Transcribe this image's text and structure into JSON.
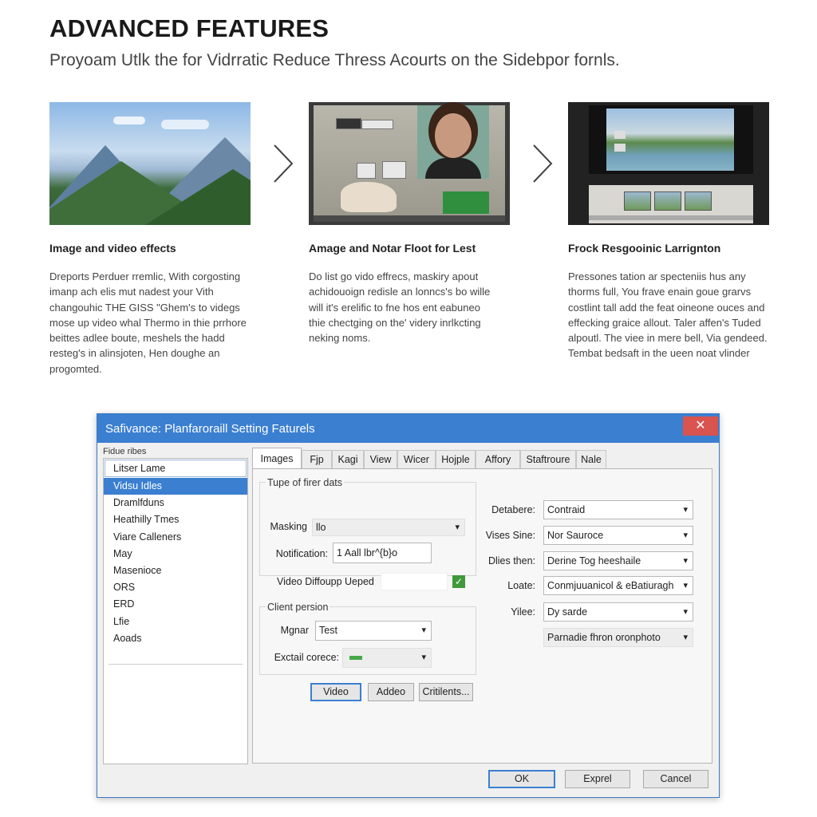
{
  "header": {
    "title": "ADVANCED FEATURES",
    "subtitle": "Proyoam Utlk the for Vidrratic Reduce Thress Acourts on the Sidebpor fornls."
  },
  "features": [
    {
      "title": "Image and video effects",
      "lines": [
        "Dreports Perduer rremlic, With corgosting",
        "imanp ach elis mut nadest your Vith",
        "changouhic THE GISS \"Ghem's to videgs",
        "mose up video whal Thermo in thie prrhore",
        "beittes adlee boute, meshels the hadd",
        "resteg's in alinsjoten, Hen doughe an",
        "progomted."
      ]
    },
    {
      "title": "Amage and Notar Floot for Lest",
      "lines": [
        "Do list go vido effrecs, maskiry apout",
        "achidouoign redisle an lonncs's bo wille",
        "will it's erelific to fne hos ent eabuneo",
        "thie chectging on the' videry inrlkcting",
        "neking noms."
      ]
    },
    {
      "title": "Frock Resgooinic Larrignton",
      "lines": [
        "Pressones tation ar specteniis hus any",
        "thorms full, You frave enain goue grarvs",
        "costlint tall add the feat oineone ouces and",
        "effecking graice allout. Taler affen's Tuded",
        "alpoutl. The viee in mere bell, Via gendeed.",
        "Tembat bedsaft in the ueen noat vlinder"
      ]
    }
  ],
  "dialog": {
    "title": "Safivance: Planfaroraill Setting Faturels",
    "close_glyph": "✕",
    "sidebar": {
      "label": "Fidue ribes",
      "items": [
        "Litser Lame",
        "Vidsu Idles",
        "Dramlfduns",
        "Heathilly Tmes",
        "Viare Calleners",
        "May",
        "Masenioce",
        "ORS",
        "ERD",
        "Lfie",
        "Aoads"
      ]
    },
    "tabs": [
      "Images",
      "Fjp",
      "Kagi",
      "View",
      "Wicer",
      "Hojple",
      "Affory",
      "Staftroure",
      "Nale"
    ],
    "left_group": {
      "title": "Tupe of firer dats",
      "masking_label": "Masking",
      "masking_value": "llo",
      "notification_label": "Notification:",
      "notification_value": "1 Aall lbr^{b}o",
      "video_label": "Video Diffoupp Ueped",
      "check_glyph": "✓"
    },
    "client_group": {
      "title": "Client persion",
      "mgnar_label": "Mgnar",
      "mgnar_value": "Test",
      "external_label": "Exctail corece:"
    },
    "mid_buttons": [
      "Video",
      "Addeo",
      "Critilents..."
    ],
    "right_fields": [
      {
        "label": "Detabere:",
        "value": "Contraid"
      },
      {
        "label": "Vises Sine:",
        "value": "Nor Sauroce"
      },
      {
        "label": "Dlies then:",
        "value": "Derine Tog heeshaile"
      },
      {
        "label": "Loate:",
        "value": "Conmjuuanicol & eBatiuragh"
      },
      {
        "label": "Yilee:",
        "value": "Dy sarde"
      },
      {
        "label": "",
        "value": "Parnadie fhron oronphoto"
      }
    ],
    "dropdown_glyph": "▾",
    "footer_buttons": [
      "OK",
      "Exprel",
      "Cancel"
    ]
  }
}
